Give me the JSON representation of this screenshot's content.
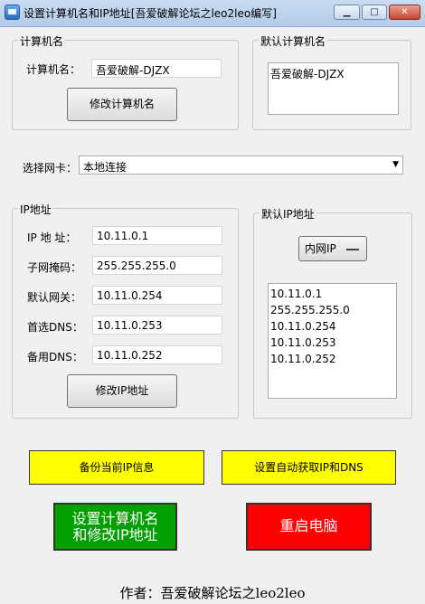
{
  "window": {
    "title": "设置计算机名和IP地址[吾爱破解论坛之leo2leo编写]",
    "minimize_glyph": "▁",
    "maximize_glyph": "□",
    "close_glyph": "✕"
  },
  "computer_name_group": {
    "legend": "计算机名",
    "label": "计算机名：",
    "value": "吾爱破解-DJZX",
    "button": "修改计算机名"
  },
  "default_name_group": {
    "legend": "默认计算机名",
    "value": "吾爱破解-DJZX"
  },
  "adapter": {
    "label": "选择网卡：",
    "selected": "本地连接",
    "arrow": "▼"
  },
  "ip_group": {
    "legend": "IP地址",
    "rows": [
      {
        "label": "IP 地 址：",
        "value": "10.11.0.1"
      },
      {
        "label": "子网掩码：",
        "value": "255.255.255.0"
      },
      {
        "label": "默认网关：",
        "value": "10.11.0.254"
      },
      {
        "label": "首选DNS：",
        "value": "10.11.0.253"
      },
      {
        "label": "备用DNS：",
        "value": "10.11.0.252"
      }
    ],
    "button": "修改IP地址"
  },
  "default_ip_group": {
    "legend": "默认IP地址",
    "dropdown": "内网IP",
    "list": [
      "10.11.0.1",
      "255.255.255.0",
      "10.11.0.254",
      "10.11.0.253",
      "10.11.0.252"
    ]
  },
  "actions": {
    "backup": "备份当前IP信息",
    "auto_dns": "设置自动获取IP和DNS",
    "set_line1": "设置计算机名",
    "set_line2": "和修改IP地址",
    "restart": "重启电脑"
  },
  "footer": {
    "author": "作者：吾爱破解论坛之leo2leo"
  },
  "colors": {
    "yellow_button": "#ffff00",
    "green_button": "#00a000",
    "red_button": "#ff0000"
  }
}
